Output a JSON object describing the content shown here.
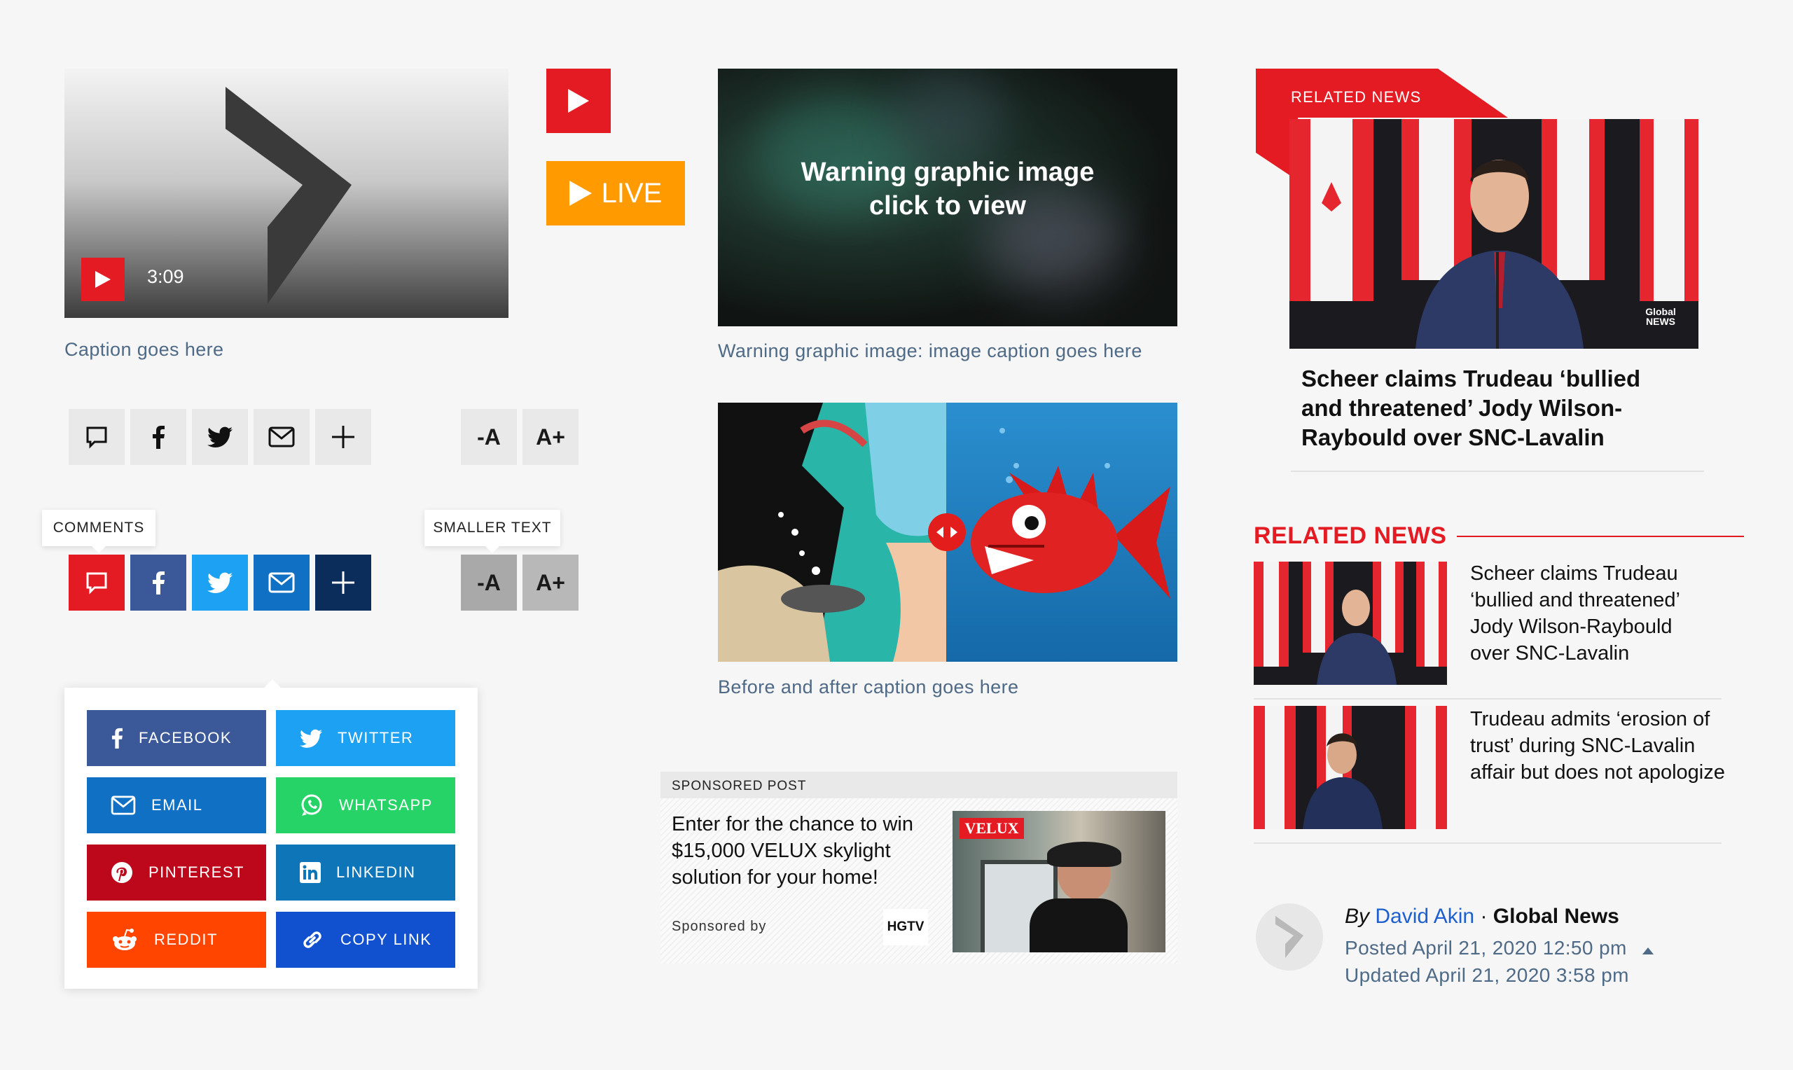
{
  "video": {
    "duration": "3:09",
    "caption": "Caption goes here"
  },
  "live_button": {
    "label": "LIVE"
  },
  "warning": {
    "line1": "Warning graphic image",
    "line2": "click to view",
    "caption": "Warning graphic image: image caption goes here"
  },
  "share_row": {
    "items": [
      "comments-icon",
      "facebook-icon",
      "twitter-icon",
      "email-icon",
      "plus-icon"
    ],
    "text_size_smaller": "-A",
    "text_size_larger": "A+"
  },
  "share_row_hover": {
    "comments_tooltip": "COMMENTS",
    "smaller_tooltip": "SMALLER TEXT",
    "text_size_smaller": "-A",
    "text_size_larger": "A+"
  },
  "share_menu": {
    "items": [
      {
        "label": "FACEBOOK",
        "color": "#3b5998",
        "icon": "facebook-icon"
      },
      {
        "label": "TWITTER",
        "color": "#1da1f2",
        "icon": "twitter-icon"
      },
      {
        "label": "EMAIL",
        "color": "#1070c4",
        "icon": "email-icon"
      },
      {
        "label": "WHATSAPP",
        "color": "#25d366",
        "icon": "whatsapp-icon"
      },
      {
        "label": "PINTEREST",
        "color": "#bd081c",
        "icon": "pinterest-icon"
      },
      {
        "label": "LINKEDIN",
        "color": "#0e76b8",
        "icon": "linkedin-icon"
      },
      {
        "label": "REDDIT",
        "color": "#ff4500",
        "icon": "reddit-icon"
      },
      {
        "label": "COPY LINK",
        "color": "#1150cf",
        "icon": "link-icon"
      }
    ]
  },
  "before_after": {
    "caption": "Before and after caption goes here"
  },
  "sponsored": {
    "label": "SPONSORED POST",
    "title": "Enter for the chance to win $15,000 VELUX skylight solution for your home!",
    "sponsored_by": "Sponsored by",
    "logo_text": "HGTV",
    "image_brand": "VELUX"
  },
  "related_hero": {
    "tab_label": "RELATED NEWS",
    "title": "Scheer claims Trudeau ‘bullied and threatened’ Jody Wilson-Raybould over SNC-Lavalin",
    "watermark": "Global NEWS"
  },
  "related_list": {
    "heading": "RELATED NEWS",
    "items": [
      {
        "title": "Scheer claims Trudeau ‘bullied and threatened’ Jody Wilson-Raybould over SNC-Lavalin"
      },
      {
        "title": "Trudeau admits ‘erosion of trust’ during SNC-Lavalin affair but does not apologize"
      }
    ]
  },
  "byline": {
    "by": "By",
    "author": "David Akin",
    "separator": "·",
    "outlet": "Global News",
    "posted": "Posted April 21, 2020 12:50 pm",
    "updated": "Updated April 21, 2020 3:58 pm"
  },
  "colors": {
    "brand_red": "#e41b23",
    "live_orange": "#ff9b00",
    "caption_blue": "#4e6a86",
    "link_blue": "#1e5fd0"
  }
}
